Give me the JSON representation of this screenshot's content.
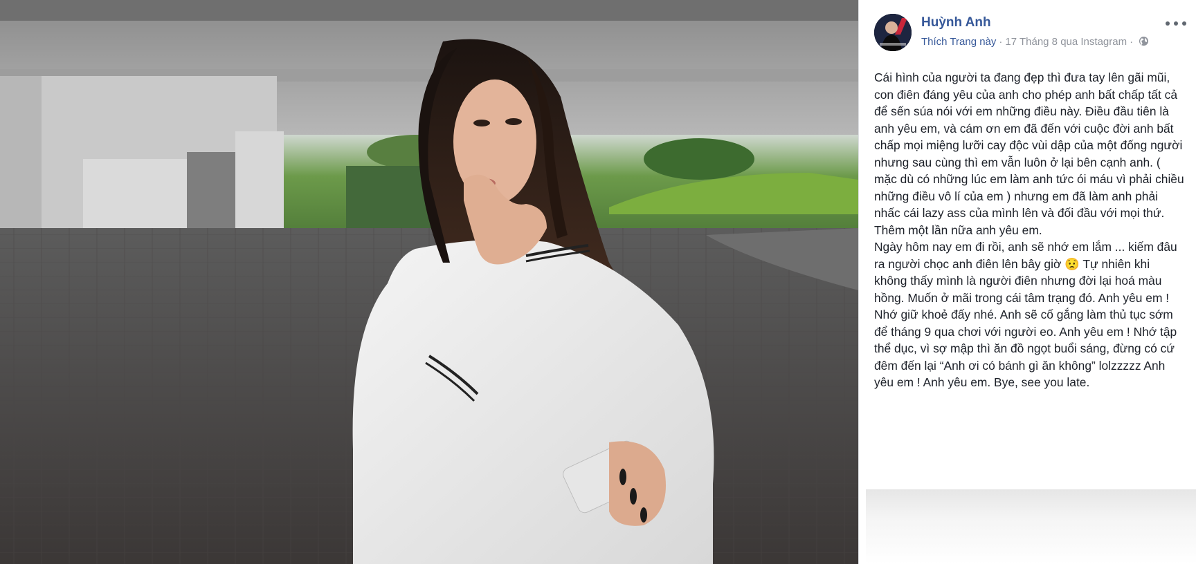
{
  "post": {
    "author": "Huỳnh Anh",
    "like_page": "Thích Trang này",
    "timestamp": "17 Tháng 8 qua Instagram",
    "privacy_icon": "globe-icon",
    "options_icon": "more-icon",
    "text_p1": "Cái hình của người ta đang đẹp thì đưa tay lên gãi mũi, con điên đáng yêu của anh cho phép anh bất chấp tất cả để sến súa nói với em những điều này. Điều đầu tiên là anh yêu em, và cám ơn em đã đến với cuộc đời anh bất chấp mọi miệng lưỡi cay độc vùi dập của một đống người nhưng sau cùng thì em vẫn luôn ở lại bên cạnh anh. ( mặc dù có những lúc em làm anh tức ói máu vì phải chiều những điều vô lí của em ) nhưng em đã làm anh phải nhấc cái lazy ass của mình lên và đối đầu với mọi thứ. Thêm một lần nữa anh yêu em.",
    "text_p2a": "Ngày hôm nay em đi rồi, anh sẽ nhớ em lắm ... kiếm đâu ra người chọc anh điên lên bây giờ ",
    "emoji": "😟",
    "text_p2b": " Tự nhiên khi không thấy mình là người điên nhưng đời lại hoá màu hồng. Muốn ở mãi trong cái tâm trạng đó. Anh yêu em ! Nhớ giữ khoẻ đấy nhé. Anh sẽ cố gắng làm thủ tục sớm để tháng 9 qua chơi với người eo. Anh yêu em ! Nhớ tập thể dục, vì sợ mập thì ăn đồ ngọt buổi sáng, đừng có cứ đêm đến lại “Anh ơi có bánh gì ăn không” lolzzzzz Anh yêu em ! Anh yêu em. Bye, see you late."
  },
  "photo": {
    "description_icon": "photo-image"
  },
  "colors": {
    "link": "#365899",
    "meta": "#90949c",
    "text": "#1d2129"
  }
}
